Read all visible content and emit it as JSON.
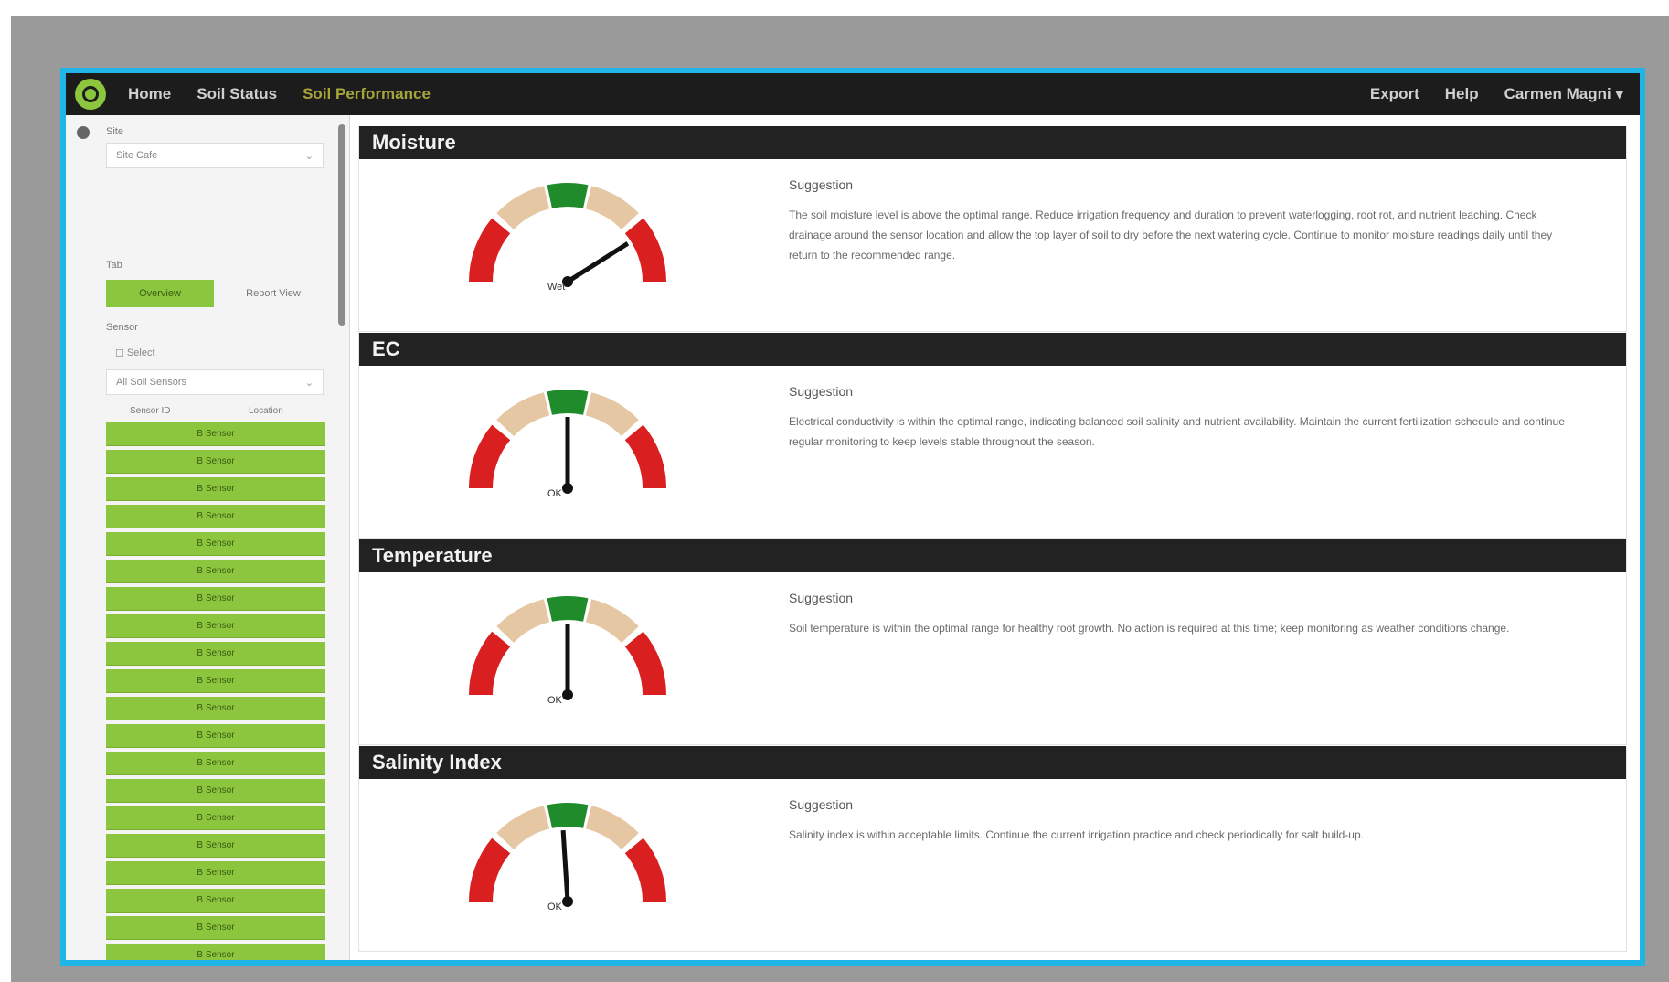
{
  "nav": {
    "home": "Home",
    "soil_status": "Soil Status",
    "soil_performance": "Soil Performance",
    "export": "Export",
    "help": "Help",
    "user": "Carmen Magni"
  },
  "sidebar": {
    "site_label": "Site",
    "site_value": "Site Cafe",
    "tab_label": "Tab",
    "tab_active": "Overview",
    "tab_other": "Report View",
    "sensor_label": "Sensor",
    "sensor_check": "Select",
    "sensor_select": "All Soil Sensors",
    "col_a": "Sensor ID",
    "col_b": "Location",
    "items": [
      "B Sensor",
      "B Sensor",
      "B Sensor",
      "B Sensor",
      "B Sensor",
      "B Sensor",
      "B Sensor",
      "B Sensor",
      "B Sensor",
      "B Sensor",
      "B Sensor",
      "B Sensor",
      "B Sensor",
      "B Sensor",
      "B Sensor",
      "B Sensor",
      "B Sensor",
      "B Sensor",
      "B Sensor",
      "B Sensor",
      "B Sensor",
      "B Sensor"
    ]
  },
  "sections": [
    {
      "title": "Moisture",
      "gauge_label": "Wet",
      "gauge_fraction": 0.82,
      "suggestion_title": "Suggestion",
      "suggestion_text": "The soil moisture level is above the optimal range. Reduce irrigation frequency and duration to prevent waterlogging, root rot, and nutrient leaching. Check drainage around the sensor location and allow the top layer of soil to dry before the next watering cycle. Continue to monitor moisture readings daily until they return to the recommended range."
    },
    {
      "title": "EC",
      "gauge_label": "OK",
      "gauge_fraction": 0.5,
      "suggestion_title": "Suggestion",
      "suggestion_text": "Electrical conductivity is within the optimal range, indicating balanced soil salinity and nutrient availability. Maintain the current fertilization schedule and continue regular monitoring to keep levels stable throughout the season."
    },
    {
      "title": "Temperature",
      "gauge_label": "OK",
      "gauge_fraction": 0.5,
      "suggestion_title": "Suggestion",
      "suggestion_text": "Soil temperature is within the optimal range for healthy root growth. No action is required at this time; keep monitoring as weather conditions change."
    },
    {
      "title": "Salinity Index",
      "gauge_label": "OK",
      "gauge_fraction": 0.48,
      "suggestion_title": "Suggestion",
      "suggestion_text": "Salinity index is within acceptable limits. Continue the current irrigation practice and check periodically for salt build-up."
    }
  ],
  "colors": {
    "accent": "#8cc63f",
    "frame_border": "#1fb5e6",
    "gauge_red": "#d91f1f",
    "gauge_beige": "#e6c7a4",
    "gauge_green": "#1f8b2a",
    "header_dark": "#222222"
  }
}
